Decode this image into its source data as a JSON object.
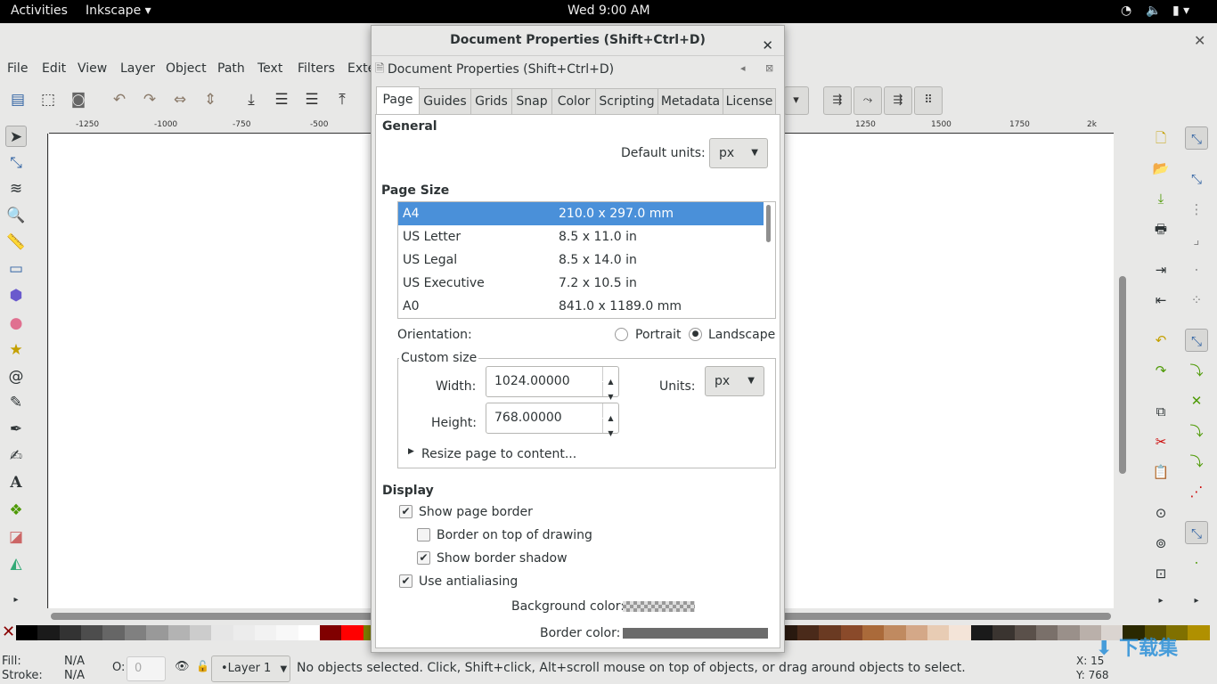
{
  "topbar": {
    "activities": "Activities",
    "app": "Inkscape",
    "clock": "Wed  9:00 AM"
  },
  "menu": [
    "File",
    "Edit",
    "View",
    "Layer",
    "Object",
    "Path",
    "Text",
    "Filters",
    "Exte"
  ],
  "ruler": {
    "h_ticks": [
      "-1250",
      "-1000",
      "-750",
      "-500",
      "1250",
      "1500",
      "1750",
      "2k"
    ]
  },
  "palette": [
    "#000000",
    "#1a1a1a",
    "#333333",
    "#4d4d4d",
    "#666666",
    "#808080",
    "#999999",
    "#b3b3b3",
    "#cccccc",
    "#e6e6e6",
    "#ececec",
    "#f2f2f2",
    "#f8f8f8",
    "#ffffff",
    "#800000",
    "#ff0000",
    "#808000",
    "#ffff00",
    "#008000",
    "#00ff00",
    "#008080",
    "#00ffff",
    "#000080",
    "#0000ff",
    "#800080",
    "#6b2a00",
    "#8a3a0a",
    "#b04a10",
    "#d45a10",
    "#ff6600",
    "#ff8833",
    "#ffa066",
    "#ffbb88",
    "#ffd0aa",
    "#ffe8d5",
    "#2a1a10",
    "#4a2a1a",
    "#6a3a22",
    "#8a4a2a",
    "#aa6a3a",
    "#c08a60",
    "#d4a888",
    "#e8ccb4",
    "#f4e4d8",
    "#1a1a1a",
    "#3a3430",
    "#5a504a",
    "#7a706a",
    "#9a908a",
    "#bab0aa",
    "#dad4d0",
    "#2a2800",
    "#5a5000",
    "#807000",
    "#b09000"
  ],
  "status": {
    "fill_label": "Fill:",
    "fill_value": "N/A",
    "stroke_label": "Stroke:",
    "stroke_value": "N/A",
    "opacity_label": "O:",
    "opacity_value": "0",
    "layer": "•Layer 1",
    "message": "No objects selected. Click, Shift+click, Alt+scroll mouse on top of objects, or drag around objects to select.",
    "x_label": "X: 15",
    "y_label": "Y: 768"
  },
  "watermark": "下载集 xzji.com",
  "dialog": {
    "title": "Document Properties (Shift+Ctrl+D)",
    "panel_title": "Document Properties (Shift+Ctrl+D)",
    "tabs": [
      "Page",
      "Guides",
      "Grids",
      "Snap",
      "Color",
      "Scripting",
      "Metadata",
      "License"
    ],
    "active_tab": "Page",
    "general": "General",
    "default_units_label": "Default units:",
    "default_units": "px",
    "page_size": "Page Size",
    "sizes": [
      {
        "name": "A4",
        "size": "210.0 x 297.0 mm",
        "selected": true
      },
      {
        "name": "US Letter",
        "size": "8.5 x 11.0 in"
      },
      {
        "name": "US Legal",
        "size": "8.5 x 14.0 in"
      },
      {
        "name": "US Executive",
        "size": "7.2 x 10.5 in"
      },
      {
        "name": "A0",
        "size": "841.0 x 1189.0 mm"
      }
    ],
    "orientation_label": "Orientation:",
    "portrait": "Portrait",
    "landscape": "Landscape",
    "orientation": "Landscape",
    "custom_size": "Custom size",
    "width_label": "Width:",
    "width": "1024.00000",
    "height_label": "Height:",
    "height": "768.00000",
    "units_label": "Units:",
    "units": "px",
    "resize": "Resize page to content...",
    "display": "Display",
    "show_page_border": "Show page border",
    "border_on_top": "Border on top of drawing",
    "show_border_shadow": "Show border shadow",
    "use_antialiasing": "Use antialiasing",
    "checks": {
      "show_page_border": true,
      "border_on_top": false,
      "show_border_shadow": true,
      "use_antialiasing": true
    },
    "background_color_label": "Background color:",
    "border_color_label": "Border color:",
    "border_color": "#6b6b6b",
    "selection_color": "#4a90d9"
  }
}
